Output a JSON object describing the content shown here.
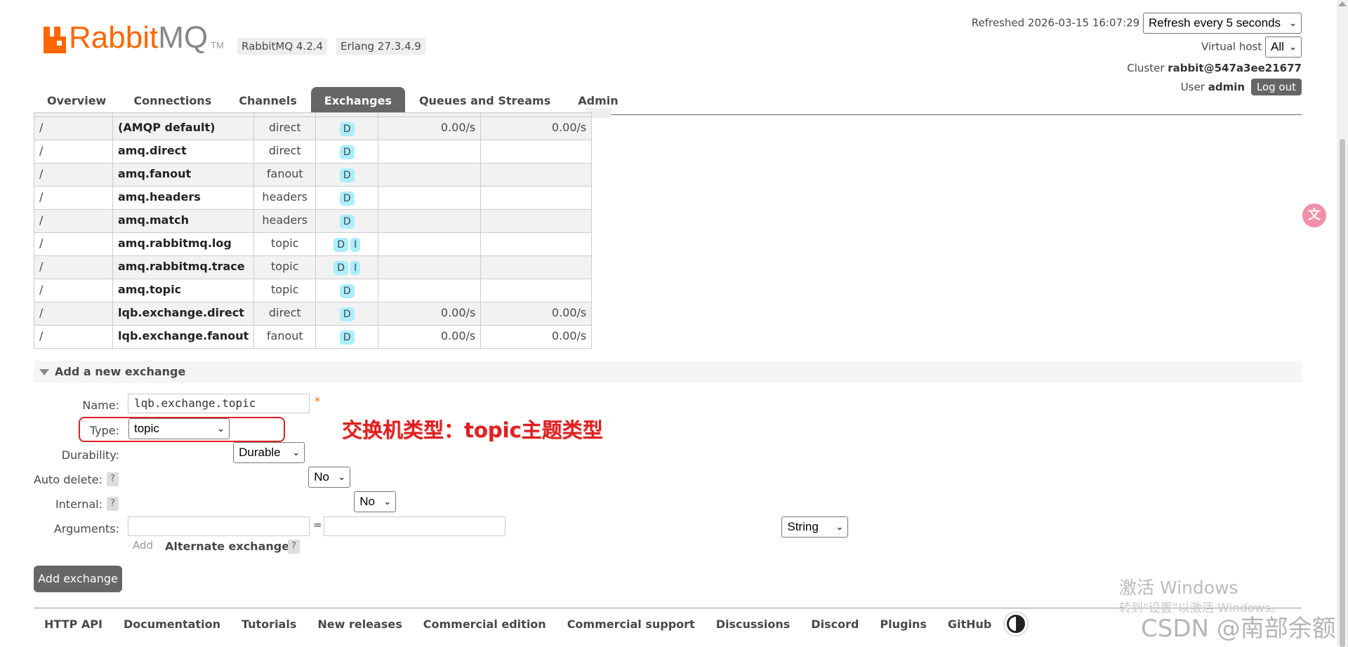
{
  "header": {
    "logo_left": "Rabbit",
    "logo_right": "MQ",
    "logo_tm": "TM",
    "version": "RabbitMQ 4.2.4",
    "erlang": "Erlang 27.3.4.9",
    "refreshed_label": "Refreshed",
    "refreshed_time": "2026-03-15 16:07:29",
    "refresh_select": "Refresh every 5 seconds",
    "vhost_label": "Virtual host",
    "vhost_select": "All",
    "cluster_label": "Cluster",
    "cluster_name": "rabbit@547a3ee21677",
    "user_label": "User",
    "user_name": "admin",
    "logout_label": "Log out"
  },
  "tabs": [
    {
      "label": "Overview"
    },
    {
      "label": "Connections"
    },
    {
      "label": "Channels"
    },
    {
      "label": "Exchanges",
      "active": true
    },
    {
      "label": "Queues and Streams"
    },
    {
      "label": "Admin"
    }
  ],
  "exchanges": [
    {
      "vhost": "/",
      "name": "(AMQP default)",
      "type": "direct",
      "features": [
        "D"
      ],
      "rate_in": "0.00/s",
      "rate_out": "0.00/s"
    },
    {
      "vhost": "/",
      "name": "amq.direct",
      "type": "direct",
      "features": [
        "D"
      ],
      "rate_in": "",
      "rate_out": ""
    },
    {
      "vhost": "/",
      "name": "amq.fanout",
      "type": "fanout",
      "features": [
        "D"
      ],
      "rate_in": "",
      "rate_out": ""
    },
    {
      "vhost": "/",
      "name": "amq.headers",
      "type": "headers",
      "features": [
        "D"
      ],
      "rate_in": "",
      "rate_out": ""
    },
    {
      "vhost": "/",
      "name": "amq.match",
      "type": "headers",
      "features": [
        "D"
      ],
      "rate_in": "",
      "rate_out": ""
    },
    {
      "vhost": "/",
      "name": "amq.rabbitmq.log",
      "type": "topic",
      "features": [
        "D",
        "I"
      ],
      "rate_in": "",
      "rate_out": ""
    },
    {
      "vhost": "/",
      "name": "amq.rabbitmq.trace",
      "type": "topic",
      "features": [
        "D",
        "I"
      ],
      "rate_in": "",
      "rate_out": ""
    },
    {
      "vhost": "/",
      "name": "amq.topic",
      "type": "topic",
      "features": [
        "D"
      ],
      "rate_in": "",
      "rate_out": ""
    },
    {
      "vhost": "/",
      "name": "lqb.exchange.direct",
      "type": "direct",
      "features": [
        "D"
      ],
      "rate_in": "0.00/s",
      "rate_out": "0.00/s"
    },
    {
      "vhost": "/",
      "name": "lqb.exchange.fanout",
      "type": "fanout",
      "features": [
        "D"
      ],
      "rate_in": "0.00/s",
      "rate_out": "0.00/s"
    }
  ],
  "add_exchange": {
    "section_title": "Add a new exchange",
    "name_label": "Name:",
    "name_value": "lqb.exchange.topic",
    "required_mark": "*",
    "type_label": "Type:",
    "type_value": "topic",
    "durability_label": "Durability:",
    "durability_value": "Durable",
    "auto_delete_label": "Auto delete:",
    "auto_delete_value": "No",
    "internal_label": "Internal:",
    "internal_value": "No",
    "arguments_label": "Arguments:",
    "arguments_key": "",
    "arguments_equals": "=",
    "arguments_value": "",
    "arguments_type": "String",
    "add_label": "Add",
    "alternate_exchange_label": "Alternate exchange",
    "help_mark": "?",
    "submit_label": "Add exchange"
  },
  "annotation": {
    "text": "交换机类型：topic主题类型",
    "color": "#e02020"
  },
  "footer": {
    "links": [
      "HTTP API",
      "Documentation",
      "Tutorials",
      "New releases",
      "Commercial edition",
      "Commercial support",
      "Discussions",
      "Discord",
      "Plugins",
      "GitHub"
    ]
  },
  "watermarks": {
    "activate_title": "激活 Windows",
    "activate_sub": "转到\"设置\"以激活 Windows。",
    "csdn": "CSDN @南部余额"
  },
  "colors": {
    "brand_orange": "#ff6600",
    "tab_active": "#666666",
    "feature_badge": "#aaeeff"
  }
}
